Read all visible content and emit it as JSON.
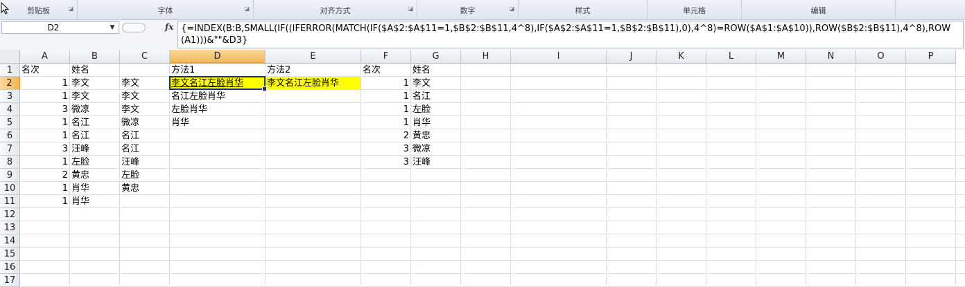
{
  "ribbon": {
    "groups": [
      "剪贴板",
      "字体",
      "对齐方式",
      "数字",
      "样式",
      "单元格",
      "编辑"
    ]
  },
  "formula_bar": {
    "name_box": "D2",
    "fx_label": "fx",
    "formula": "{=INDEX(B:B,SMALL(IF((IFERROR(MATCH(IF($A$2:$A$11=1,$B$2:$B$11,4^8),IF($A$2:$A$11=1,$B$2:$B$11),0),4^8)=ROW($A$1:$A$10)),ROW($B$2:$B$11),4^8),ROW(A1)))&\"\"&D3}"
  },
  "sheet": {
    "columns": [
      "A",
      "B",
      "C",
      "D",
      "E",
      "F",
      "G",
      "H",
      "I",
      "J",
      "K",
      "L",
      "M",
      "N",
      "O",
      "P"
    ],
    "rows": [
      "1",
      "2",
      "3",
      "4",
      "5",
      "6",
      "7",
      "8",
      "9",
      "10",
      "11",
      "12",
      "13",
      "14",
      "15",
      "16",
      "17"
    ],
    "active_cell": "D2",
    "highlight_color": "#ffff00",
    "cells": {
      "A1": "名次",
      "B1": "姓名",
      "D1": "方法1",
      "E1": "方法2",
      "F1": "名次",
      "G1": "姓名",
      "A2": "1",
      "B2": "李文",
      "C2": "李文",
      "D2": "李文名江左脸肖华",
      "E2": "李文名江左脸肖华",
      "F2": "1",
      "G2": "李文",
      "A3": "1",
      "B3": "李文",
      "C3": "李文",
      "D3": "名江左脸肖华",
      "F3": "1",
      "G3": "名江",
      "A4": "3",
      "B4": "微凉",
      "C4": "李文",
      "D4": "左脸肖华",
      "F4": "1",
      "G4": "左脸",
      "A5": "1",
      "B5": "名江",
      "C5": "微凉",
      "D5": "肖华",
      "F5": "1",
      "G5": "肖华",
      "A6": "1",
      "B6": "名江",
      "C6": "名江",
      "F6": "2",
      "G6": "黄忠",
      "A7": "3",
      "B7": "汪峰",
      "C7": "名江",
      "F7": "3",
      "G7": "微凉",
      "A8": "1",
      "B8": "左脸",
      "C8": "汪峰",
      "F8": "3",
      "G8": "汪峰",
      "A9": "2",
      "B9": "黄忠",
      "C9": "左脸",
      "A10": "1",
      "B10": "肖华",
      "C10": "黄忠",
      "A11": "1",
      "B11": "肖华"
    }
  }
}
